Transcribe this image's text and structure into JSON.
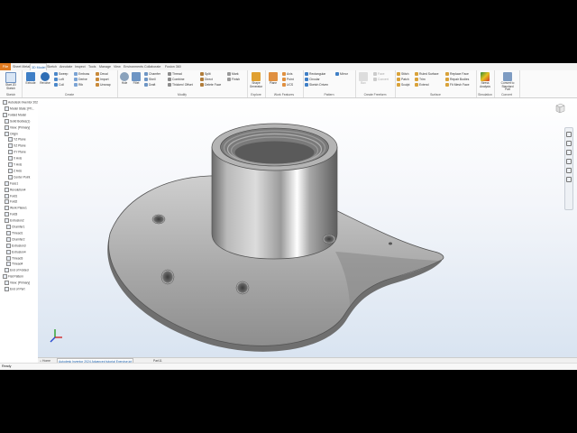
{
  "tabs": {
    "file": "File",
    "items": [
      "Sheet Metal",
      "3D Model",
      "Sketch",
      "Annotate",
      "Inspect",
      "Tools",
      "Manage",
      "View",
      "Environments",
      "Collaborate",
      "Fusion 360"
    ],
    "active": "3D Model"
  },
  "ribbon": {
    "sketch": {
      "label": "Sketch",
      "start": "Start 2D Sketch"
    },
    "create": {
      "label": "Create",
      "extrude": "Extrude",
      "revolve": "Revolve",
      "sweep": "Sweep",
      "loft": "Loft",
      "coil": "Coil",
      "emboss": "Emboss",
      "derive": "Derive",
      "rib": "Rib",
      "decal": "Decal",
      "import": "Import",
      "unwrap": "Unwrap"
    },
    "modify": {
      "label": "Modify",
      "hole": "Hole",
      "fillet": "Fillet",
      "chamfer": "Chamfer",
      "shell": "Shell",
      "draft": "Draft",
      "thread": "Thread",
      "combine": "Combine",
      "thicken": "Thicken/ Offset",
      "split": "Split",
      "direct": "Direct",
      "delete_face": "Delete Face",
      "mark": "Mark",
      "finish": "Finish"
    },
    "explore": {
      "label": "Explore",
      "shape_generator": "Shape Generator"
    },
    "work": {
      "label": "Work Features",
      "plane": "Plane",
      "axis": "Axis",
      "point": "Point",
      "ucs": "UCS"
    },
    "pattern": {
      "label": "Pattern",
      "rectangular": "Rectangular",
      "circular": "Circular",
      "sketch_driven": "Sketch Driven",
      "mirror": "Mirror"
    },
    "freeform": {
      "label": "Create Freeform",
      "box": "Box",
      "face": "Face",
      "convert": "Convert"
    },
    "surface": {
      "label": "Surface",
      "stitch": "Stitch",
      "patch": "Patch",
      "sculpt": "Sculpt",
      "ruled": "Ruled Surface",
      "trim": "Trim",
      "extend": "Extend",
      "replace_face": "Replace Face",
      "repair_bodies": "Repair Bodies",
      "fit_mesh_face": "Fit Mesh Face"
    },
    "simulation": {
      "label": "Simulation",
      "stress": "Stress Analysis"
    },
    "convert": {
      "label": "Convert",
      "to_standard": "Convert to Standard Part"
    }
  },
  "browser": {
    "items": [
      {
        "label": "Autodesk Inventor 2024",
        "indent": 1
      },
      {
        "label": "Model State: [Pri...",
        "indent": 2
      },
      {
        "label": "Folded Model",
        "indent": 1
      },
      {
        "label": "Solid Bodies(1)",
        "indent": 2
      },
      {
        "label": "View: [Primary]",
        "indent": 2
      },
      {
        "label": "Origin",
        "indent": 2
      },
      {
        "label": "YZ Plane",
        "indent": 4
      },
      {
        "label": "XZ Plane",
        "indent": 4
      },
      {
        "label": "XY Plane",
        "indent": 4
      },
      {
        "label": "X Axis",
        "indent": 4
      },
      {
        "label": "Y Axis",
        "indent": 4
      },
      {
        "label": "Z Axis",
        "indent": 4
      },
      {
        "label": "Center Point",
        "indent": 4
      },
      {
        "label": "Face1",
        "indent": 2
      },
      {
        "label": "Revolution4",
        "indent": 2
      },
      {
        "label": "Fold1",
        "indent": 2
      },
      {
        "label": "Fold2",
        "indent": 2
      },
      {
        "label": "Work Plane1",
        "indent": 2
      },
      {
        "label": "Fold3",
        "indent": 2
      },
      {
        "label": "Extrusion2",
        "indent": 2
      },
      {
        "label": "Chamfer1",
        "indent": 3
      },
      {
        "label": "Thread1",
        "indent": 3
      },
      {
        "label": "Chamfer2",
        "indent": 3
      },
      {
        "label": "Extrusion3",
        "indent": 3
      },
      {
        "label": "Extrusion4",
        "indent": 3
      },
      {
        "label": "Thread3",
        "indent": 3
      },
      {
        "label": "Thread4",
        "indent": 3
      },
      {
        "label": "End of Folded",
        "indent": 2
      },
      {
        "label": "Flat Pattern",
        "indent": 1
      },
      {
        "label": "View: [Primary]",
        "indent": 2
      },
      {
        "label": "End of Part",
        "indent": 2
      }
    ]
  },
  "doc_tabs": {
    "home": "Home",
    "active": "Autodesk Inventor 2024 Advanced tutorial Exercise.ipt",
    "other": "Part11"
  },
  "status": {
    "left": "Ready"
  },
  "colors": {
    "file_tab": "#e07a1f",
    "accent": "#1a5ea8"
  }
}
